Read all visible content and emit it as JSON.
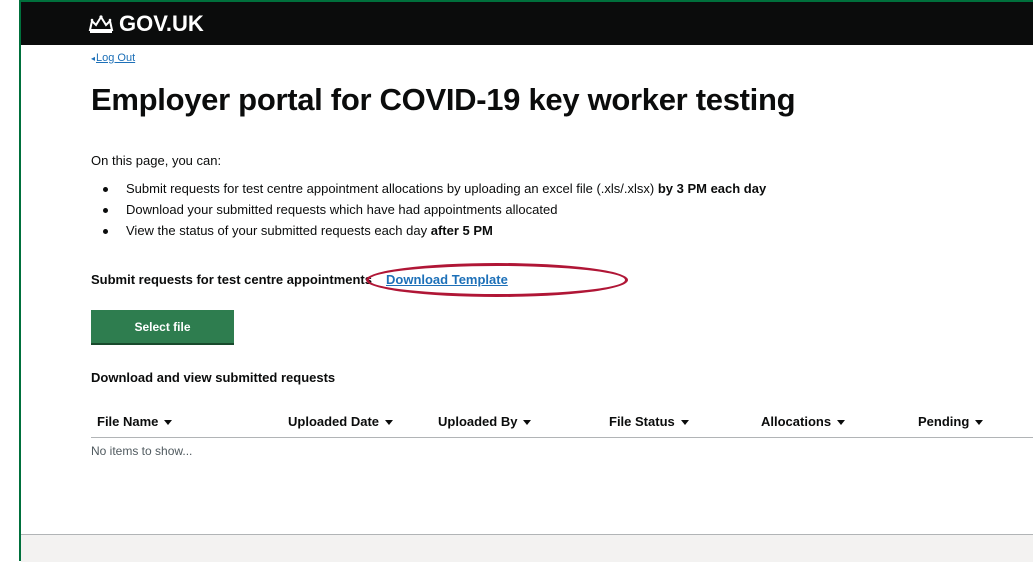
{
  "header": {
    "brand": "GOV.UK",
    "crown_icon": "crown-icon"
  },
  "nav": {
    "back_link": "Log Out"
  },
  "page": {
    "title": "Employer portal for COVID-19 key worker testing"
  },
  "intro": "On this page, you can:",
  "bullets": [
    {
      "text": "Submit requests for test centre appointment allocations by uploading an excel file (.xls/.xlsx) ",
      "bold": "by 3 PM each day"
    },
    {
      "text": "Download your submitted requests which have had appointments allocated",
      "bold": ""
    },
    {
      "text": "View the status of your submitted requests each day ",
      "bold": "after 5 PM"
    }
  ],
  "submit": {
    "label": "Submit requests for test centre appointments",
    "template_link": "Download Template",
    "select_button": "Select file"
  },
  "requests": {
    "heading": "Download and view submitted requests",
    "columns": [
      "File Name",
      "Uploaded Date",
      "Uploaded By",
      "File Status",
      "Allocations",
      "Pending"
    ],
    "empty_text": "No items to show..."
  },
  "colors": {
    "header_bg": "#0b0c0c",
    "link": "#1d70b8",
    "button_green": "#2e7d4f",
    "highlight": "#b01636"
  }
}
